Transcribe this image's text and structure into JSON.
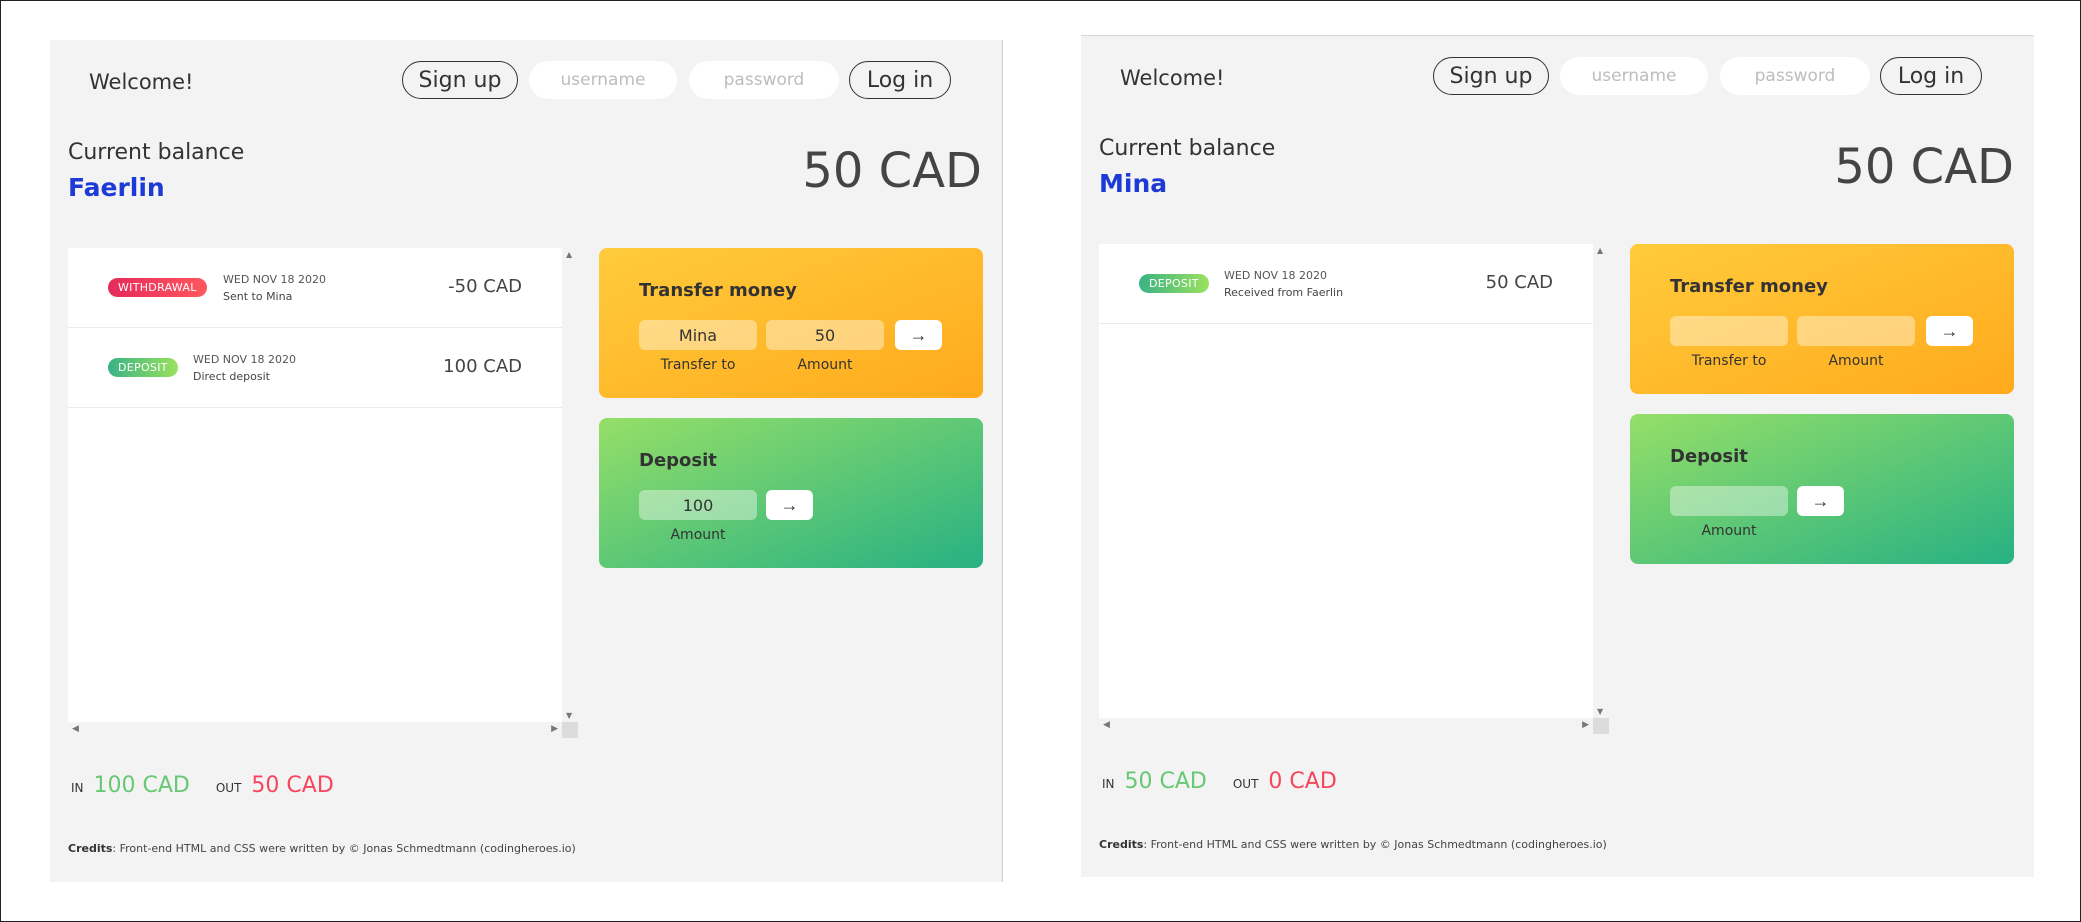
{
  "apps": [
    {
      "welcome": "Welcome!",
      "signup_label": "Sign up",
      "login_label": "Log in",
      "username_placeholder": "username",
      "password_placeholder": "password",
      "balance_label": "Current balance",
      "owner_name": "Faerlin",
      "balance_value": "50 CAD",
      "movements": [
        {
          "type": "WITHDRAWAL",
          "date": "WED NOV 18 2020",
          "description": "Sent to Mina",
          "amount": "-50 CAD"
        },
        {
          "type": "DEPOSIT",
          "date": "WED NOV 18 2020",
          "description": "Direct deposit",
          "amount": "100 CAD"
        }
      ],
      "transfer": {
        "title": "Transfer money",
        "to_value": "Mina",
        "amount_value": "50",
        "to_label": "Transfer to",
        "amount_label": "Amount",
        "button": "→"
      },
      "deposit": {
        "title": "Deposit",
        "amount_value": "100",
        "amount_label": "Amount",
        "button": "→"
      },
      "summary": {
        "in_label": "IN",
        "in_value": "100 CAD",
        "out_label": "OUT",
        "out_value": "50 CAD"
      },
      "credits_label": "Credits",
      "credits_text": ": Front-end HTML and CSS were written by © Jonas Schmedtmann (codingheroes.io)"
    },
    {
      "welcome": "Welcome!",
      "signup_label": "Sign up",
      "login_label": "Log in",
      "username_placeholder": "username",
      "password_placeholder": "password",
      "balance_label": "Current balance",
      "owner_name": "Mina",
      "balance_value": "50 CAD",
      "movements": [
        {
          "type": "DEPOSIT",
          "date": "WED NOV 18 2020",
          "description": "Received from Faerlin",
          "amount": "50 CAD"
        }
      ],
      "transfer": {
        "title": "Transfer money",
        "to_value": "",
        "amount_value": "",
        "to_label": "Transfer to",
        "amount_label": "Amount",
        "button": "→"
      },
      "deposit": {
        "title": "Deposit",
        "amount_value": "",
        "amount_label": "Amount",
        "button": "→"
      },
      "summary": {
        "in_label": "IN",
        "in_value": "50 CAD",
        "out_label": "OUT",
        "out_value": "0 CAD"
      },
      "credits_label": "Credits",
      "credits_text": ": Front-end HTML and CSS were written by © Jonas Schmedtmann (codingheroes.io)"
    }
  ],
  "icons": {
    "scroll_up": "▲",
    "scroll_down": "▼",
    "scroll_left": "◀",
    "scroll_right": "▶"
  }
}
